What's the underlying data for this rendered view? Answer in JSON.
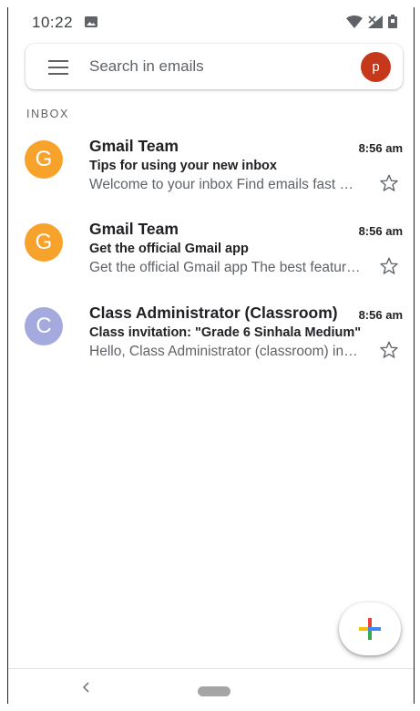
{
  "status_bar": {
    "time": "10:22",
    "icons": [
      "image-icon",
      "wifi-icon",
      "no-signal-icon",
      "battery-icon"
    ]
  },
  "search": {
    "placeholder": "Search in emails",
    "account_initial": "p",
    "account_color": "#c5381a"
  },
  "section_label": "INBOX",
  "emails": [
    {
      "avatar_letter": "G",
      "avatar_color": "#f6a22b",
      "sender": "Gmail Team",
      "time": "8:56 am",
      "subject": "Tips for using your new inbox",
      "snippet": "Welcome to your inbox Find emails fast With the search bar"
    },
    {
      "avatar_letter": "G",
      "avatar_color": "#f6a22b",
      "sender": "Gmail Team",
      "time": "8:56 am",
      "subject": "Get the official Gmail app",
      "snippet": "Get the official Gmail app The best features of Gmail"
    },
    {
      "avatar_letter": "C",
      "avatar_color": "#a4aadd",
      "sender": "Class Administrator (Classroom)",
      "time": "8:56 am",
      "subject": "Class invitation: \"Grade 6 Sinhala Medium\"",
      "snippet": "Hello, Class Administrator (classroom) invited you"
    }
  ],
  "fab": {
    "icon": "plus-icon",
    "colors": [
      "#ea4335",
      "#4285f4",
      "#34a853",
      "#fbbc04"
    ]
  },
  "nav": {
    "icons": [
      "back-icon",
      "home-pill"
    ]
  }
}
